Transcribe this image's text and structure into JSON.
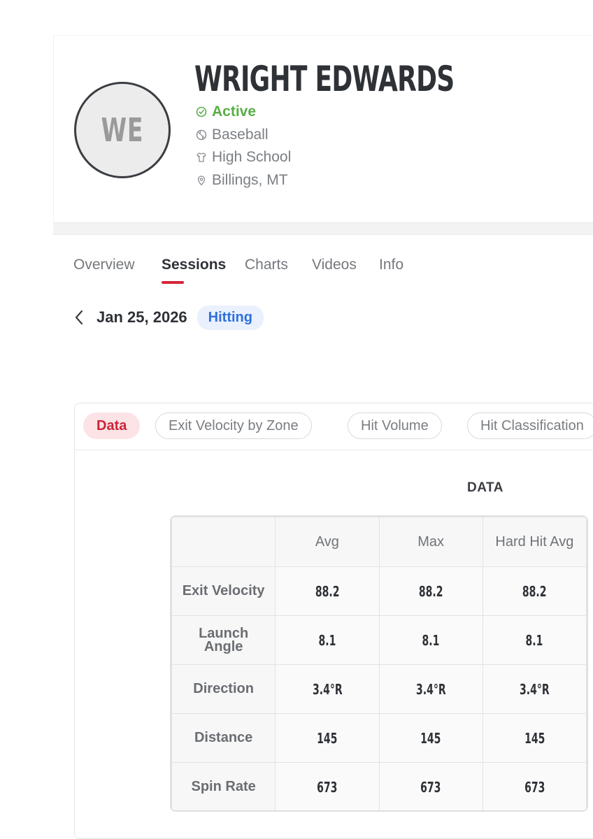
{
  "profile": {
    "initials": "WE",
    "name": "WRIGHT EDWARDS",
    "status": "Active",
    "sport": "Baseball",
    "level": "High School",
    "location": "Billings, MT"
  },
  "nav": {
    "tabs": [
      {
        "label": "Overview",
        "active": false
      },
      {
        "label": "Sessions",
        "active": true
      },
      {
        "label": "Charts",
        "active": false
      },
      {
        "label": "Videos",
        "active": false
      },
      {
        "label": "Info",
        "active": false
      }
    ]
  },
  "session": {
    "date": "Jan 25, 2026",
    "type": "Hitting"
  },
  "views": {
    "chips": [
      {
        "label": "Data",
        "active": true
      },
      {
        "label": "Exit Velocity by Zone",
        "active": false
      },
      {
        "label": "Hit Volume",
        "active": false
      },
      {
        "label": "Hit Classification",
        "active": false
      }
    ]
  },
  "data_table": {
    "title": "DATA",
    "columns": [
      "Avg",
      "Max",
      "Hard Hit Avg"
    ],
    "rows": [
      {
        "label": "Exit Velocity",
        "values": [
          "88.2",
          "88.2",
          "88.2"
        ]
      },
      {
        "label": "Launch Angle",
        "values": [
          "8.1",
          "8.1",
          "8.1"
        ]
      },
      {
        "label": "Direction",
        "values": [
          "3.4°R",
          "3.4°R",
          "3.4°R"
        ]
      },
      {
        "label": "Distance",
        "values": [
          "145",
          "145",
          "145"
        ]
      },
      {
        "label": "Spin Rate",
        "values": [
          "673",
          "673",
          "673"
        ]
      }
    ]
  },
  "colors": {
    "accent_red": "#d3263a",
    "status_green": "#5aae48",
    "badge_blue": "#2d6fdd"
  }
}
